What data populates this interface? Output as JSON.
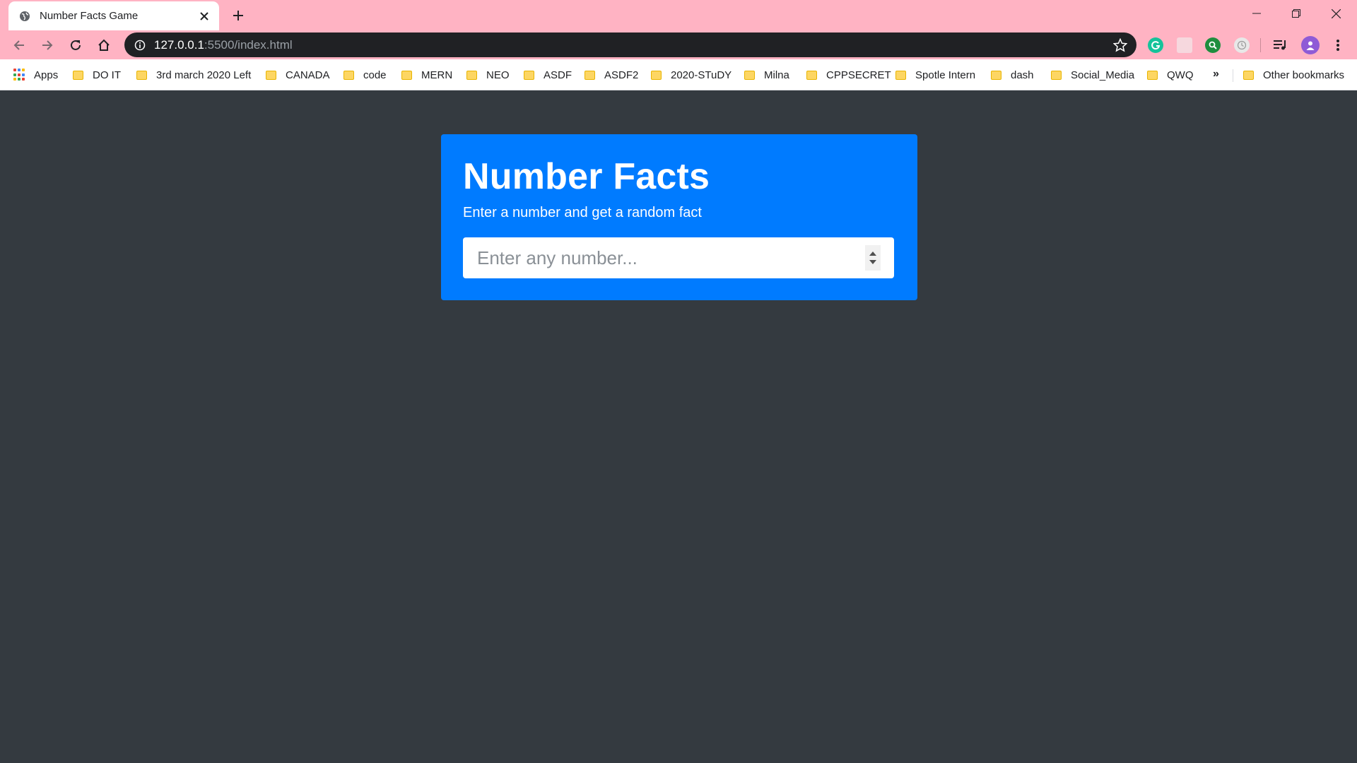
{
  "browser": {
    "tab_title": "Number Facts Game",
    "url_host": "127.0.0.1",
    "url_rest": ":5500/index.html"
  },
  "bookmarks": {
    "apps_label": "Apps",
    "items": [
      "DO IT",
      "3rd march 2020 Left",
      "CANADA",
      "code",
      "MERN",
      "NEO",
      "ASDF",
      "ASDF2",
      "2020-STuDY",
      "Milna",
      "CPPSECRET",
      "Spotle Intern",
      "dash",
      "Social_Media",
      "QWQ"
    ],
    "more_label": "»",
    "other_label": "Other bookmarks"
  },
  "page": {
    "title": "Number Facts",
    "subtitle": "Enter a number and get a random fact",
    "input_placeholder": "Enter any number...",
    "input_value": ""
  },
  "colors": {
    "chrome_pink": "#ffb3c3",
    "page_bg": "#343a40",
    "card_blue": "#007bff"
  },
  "icons": {
    "tab_favicon": "globe-icon",
    "tab_close": "close-icon",
    "new_tab": "plus-icon",
    "back": "back-arrow-icon",
    "forward": "forward-arrow-icon",
    "reload": "reload-icon",
    "home": "home-icon",
    "site_info": "info-icon",
    "bookmark_star": "star-icon"
  }
}
